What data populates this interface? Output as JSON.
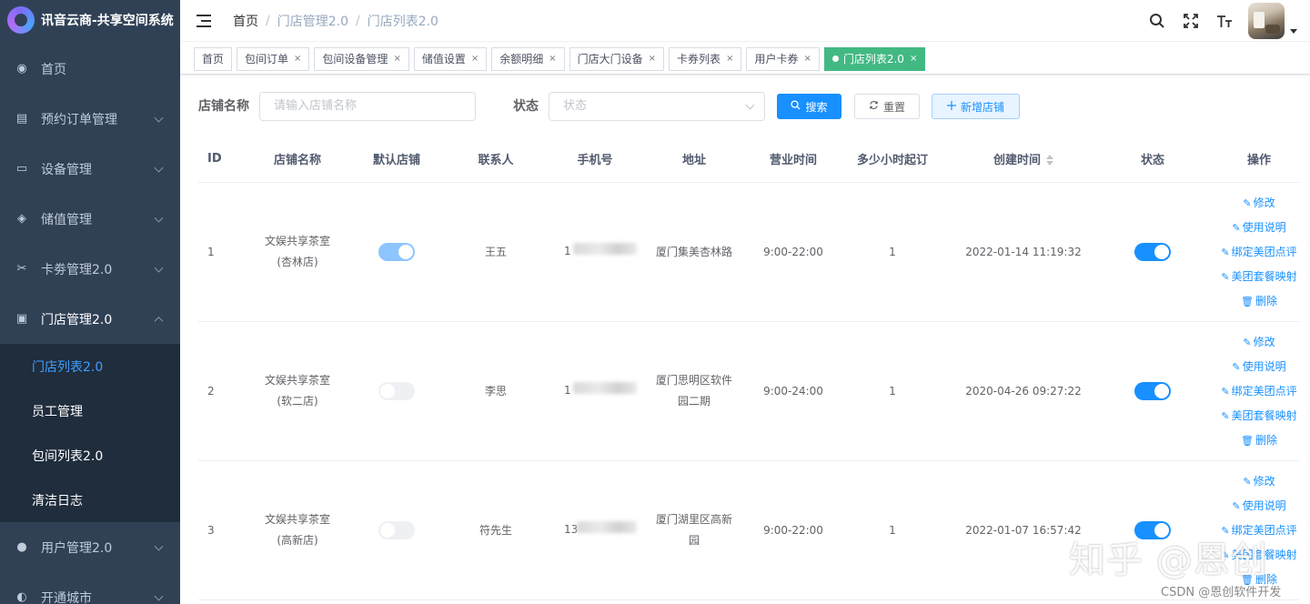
{
  "app": {
    "title": "讯音云商-共享空间系统"
  },
  "sidebar": {
    "items": [
      {
        "label": "首页",
        "icon": "dashboard-icon",
        "glyph": "◉"
      },
      {
        "label": "预约订单管理",
        "icon": "order-icon",
        "glyph": "▤"
      },
      {
        "label": "设备管理",
        "icon": "device-icon",
        "glyph": "▭"
      },
      {
        "label": "储值管理",
        "icon": "wallet-icon",
        "glyph": "◈"
      },
      {
        "label": "卡劵管理2.0",
        "icon": "coupon-icon",
        "glyph": "✂"
      },
      {
        "label": "门店管理2.0",
        "icon": "store-icon",
        "glyph": "▣"
      },
      {
        "label": "用户管理2.0",
        "icon": "user-icon",
        "glyph": "●"
      },
      {
        "label": "开通城市",
        "icon": "city-icon",
        "glyph": "◐"
      }
    ],
    "submenu": [
      "门店列表2.0",
      "员工管理",
      "包间列表2.0",
      "清洁日志"
    ]
  },
  "header": {
    "breadcrumb": [
      "首页",
      "门店管理2.0",
      "门店列表2.0"
    ],
    "icons": [
      "search-icon",
      "fullscreen-icon",
      "font-size-icon"
    ]
  },
  "tags": [
    {
      "label": "首页",
      "closable": false,
      "active": false
    },
    {
      "label": "包间订单",
      "closable": true,
      "active": false
    },
    {
      "label": "包间设备管理",
      "closable": true,
      "active": false
    },
    {
      "label": "储值设置",
      "closable": true,
      "active": false
    },
    {
      "label": "余额明细",
      "closable": true,
      "active": false
    },
    {
      "label": "门店大门设备",
      "closable": true,
      "active": false
    },
    {
      "label": "卡券列表",
      "closable": true,
      "active": false
    },
    {
      "label": "用户卡券",
      "closable": true,
      "active": false
    },
    {
      "label": "门店列表2.0",
      "closable": true,
      "active": true
    }
  ],
  "close_glyph": "×",
  "search": {
    "name_label": "店铺名称",
    "name_placeholder": "请输入店铺名称",
    "status_label": "状态",
    "status_placeholder": "状态",
    "search_button": "搜索",
    "reset_button": "重置",
    "add_button": "新增店铺"
  },
  "table": {
    "headers": [
      "ID",
      "店铺名称",
      "默认店铺",
      "联系人",
      "手机号",
      "地址",
      "营业时间",
      "多少小时起订",
      "创建时间",
      "状态",
      "操作"
    ],
    "operations": [
      "修改",
      "使用说明",
      "绑定美团点评",
      "美团套餐映射",
      "删除"
    ],
    "rows": [
      {
        "id": "1",
        "name_line1": "文娱共享茶室",
        "name_line2": "(杏林店)",
        "default": true,
        "contact": "王五",
        "phone_prefix": "1",
        "address_line1": "厦门集美杏林路",
        "address_line2": "",
        "hours": "9:00-22:00",
        "min_hours": "1",
        "created": "2022-01-14 11:19:32",
        "status": true
      },
      {
        "id": "2",
        "name_line1": "文娱共享茶室",
        "name_line2": "(软二店)",
        "default": false,
        "contact": "李思",
        "phone_prefix": "1",
        "address_line1": "厦门思明区软件",
        "address_line2": "园二期",
        "hours": "9:00-24:00",
        "min_hours": "1",
        "created": "2020-04-26 09:27:22",
        "status": true
      },
      {
        "id": "3",
        "name_line1": "文娱共享茶室",
        "name_line2": "(高新店)",
        "default": false,
        "contact": "符先生",
        "phone_prefix": "13",
        "address_line1": "厦门湖里区高新",
        "address_line2": "园",
        "hours": "9:00-22:00",
        "min_hours": "1",
        "created": "2022-01-07 16:57:42",
        "status": true
      }
    ]
  },
  "watermark": "知乎 @恩创",
  "credit": "CSDN @恩创软件开发"
}
